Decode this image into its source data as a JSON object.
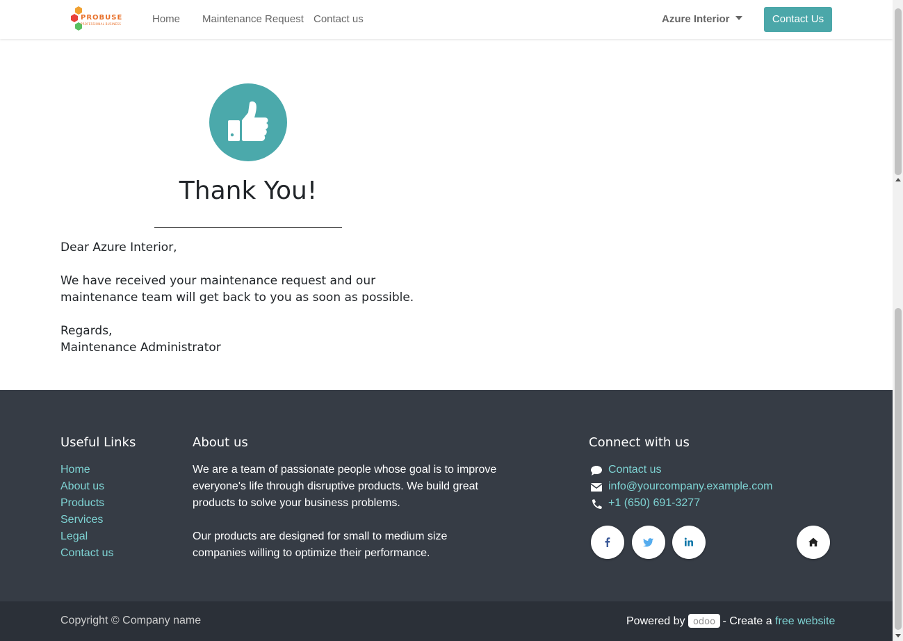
{
  "header": {
    "logo_text": "PROBUSE",
    "logo_subtext": "PROFESSIONAL BUSINESS",
    "nav": [
      "Home",
      "Maintenance Request",
      "Contact us"
    ],
    "user_name": "Azure Interior",
    "cta_label": "Contact Us"
  },
  "main": {
    "title": "Thank You!",
    "greeting": "Dear Azure Interior,",
    "body_line1": "We have received your maintenance request and our",
    "body_line2": "maintenance team will get back to you as soon as possible.",
    "regards": "Regards,",
    "signature": "Maintenance Administrator"
  },
  "footer": {
    "useful_links_title": "Useful Links",
    "useful_links": [
      "Home",
      "About us",
      "Products",
      "Services",
      "Legal",
      "Contact us"
    ],
    "about_title": "About us",
    "about_lines": [
      "We are a team of passionate people whose goal is to improve",
      "everyone's life through disruptive products. We build great",
      "products to solve your business problems."
    ],
    "about_lines2": [
      "Our products are designed for small to medium size",
      "companies willing to optimize their performance."
    ],
    "connect_title": "Connect with us",
    "contact_link": "Contact us",
    "email": "info@yourcompany.example.com",
    "phone": "+1 (650) 691-3277",
    "social_icons": [
      "facebook-icon",
      "twitter-icon",
      "linkedin-icon",
      "home-icon"
    ]
  },
  "copyright_bar": {
    "copyright": "Copyright © Company name",
    "powered_by": "Powered by",
    "odoo_logo": "odoo",
    "create_text": "- Create a",
    "free_website": "free website"
  },
  "colors": {
    "accent": "#4ba7a9",
    "footer_bg": "#363c45",
    "copyright_bg": "#2b3038",
    "link": "#7ed3d3"
  }
}
